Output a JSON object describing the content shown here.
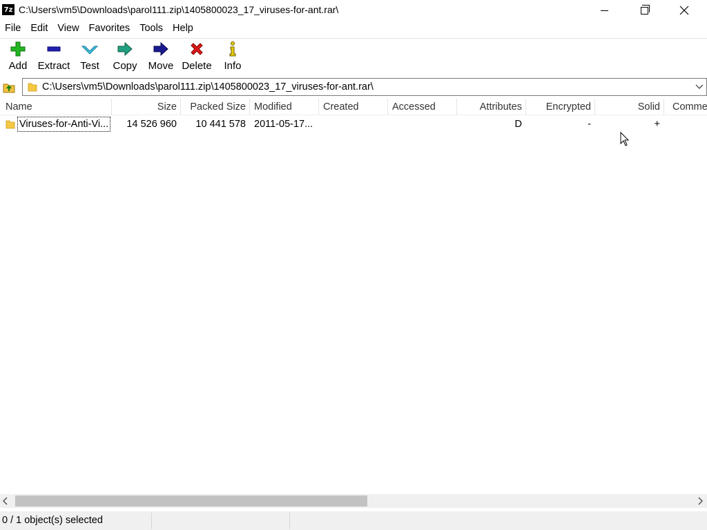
{
  "window": {
    "title": "C:\\Users\\vm5\\Downloads\\parol111.zip\\1405800023_17_viruses-for-ant.rar\\",
    "app_icon_text": "7z"
  },
  "menu": [
    "File",
    "Edit",
    "View",
    "Favorites",
    "Tools",
    "Help"
  ],
  "toolbar": [
    {
      "label": "Add",
      "icon": "plus-icon",
      "color": "#1a9e1a"
    },
    {
      "label": "Extract",
      "icon": "minus-icon",
      "color": "#1a1a9e"
    },
    {
      "label": "Test",
      "icon": "check-icon",
      "color": "#22a6c8"
    },
    {
      "label": "Copy",
      "icon": "copy-arrow-icon",
      "color": "#1a8e6a"
    },
    {
      "label": "Move",
      "icon": "move-arrow-icon",
      "color": "#1a1a8e"
    },
    {
      "label": "Delete",
      "icon": "x-icon",
      "color": "#d01010"
    },
    {
      "label": "Info",
      "icon": "info-icon",
      "color": "#c8b400"
    }
  ],
  "address": {
    "path": "C:\\Users\\vm5\\Downloads\\parol111.zip\\1405800023_17_viruses-for-ant.rar\\"
  },
  "columns": [
    "Name",
    "Size",
    "Packed Size",
    "Modified",
    "Created",
    "Accessed",
    "Attributes",
    "Encrypted",
    "Solid",
    "Comme"
  ],
  "rows": [
    {
      "name": "Viruses-for-Anti-Vi...",
      "size": "14 526 960",
      "packed_size": "10 441 578",
      "modified": "2011-05-17...",
      "created": "",
      "accessed": "",
      "attributes": "D",
      "encrypted": "-",
      "solid": "+",
      "comment": ""
    }
  ],
  "status": {
    "selection": "0 / 1 object(s) selected"
  }
}
